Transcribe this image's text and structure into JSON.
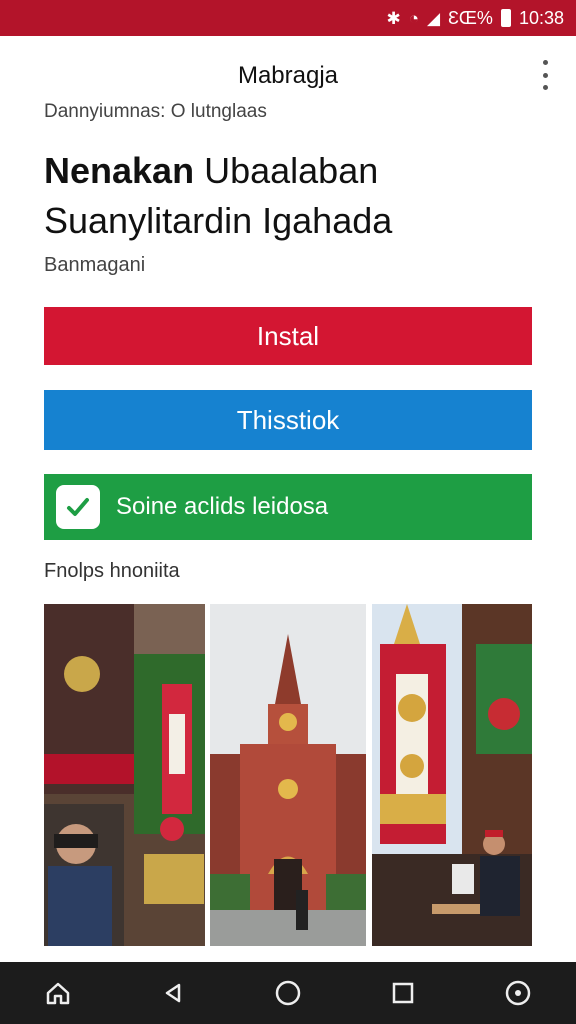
{
  "status_bar": {
    "time": "10:38",
    "battery_text": "ƐŒ%"
  },
  "app_bar": {
    "title": "Mabragja"
  },
  "app": {
    "subheader": "Dannyiumnas: O lutnglaas",
    "title_line1_bold": "Nenakan",
    "title_line1_rest": "Ubaalaban",
    "title_line2": "Suanylitardin Igahada",
    "developer": "Banmagani"
  },
  "buttons": {
    "install": "Instal",
    "secondary": "Thisstiok",
    "check_label": "Soine aclids leidosa"
  },
  "screenshots": {
    "label": "Fnolps hnoniita",
    "items": [
      "screenshot-1",
      "screenshot-2",
      "screenshot-3"
    ]
  },
  "colors": {
    "status_bar": "#b3142a",
    "install": "#d31632",
    "secondary": "#1682d0",
    "check": "#1e9e44",
    "nav_bar": "#1c1c1c"
  },
  "nav": [
    "home-icon",
    "back-icon",
    "circle-home-icon",
    "recents-icon",
    "assistant-icon"
  ]
}
